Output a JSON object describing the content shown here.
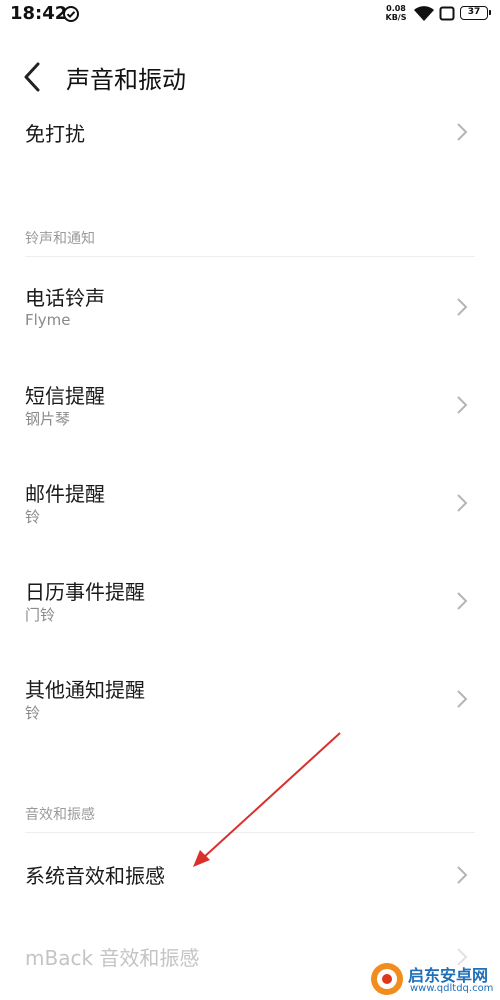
{
  "status_bar": {
    "time": "18:42",
    "net_speed_value": "0.08",
    "net_speed_unit": "KB/S",
    "battery": "37"
  },
  "header": {
    "title": "声音和振动"
  },
  "rows": {
    "dnd": {
      "title": "免打扰"
    },
    "ringtone": {
      "title": "电话铃声",
      "subtitle": "Flyme"
    },
    "sms": {
      "title": "短信提醒",
      "subtitle": "钢片琴"
    },
    "mail": {
      "title": "邮件提醒",
      "subtitle": "铃"
    },
    "calendar": {
      "title": "日历事件提醒",
      "subtitle": "门铃"
    },
    "other": {
      "title": "其他通知提醒",
      "subtitle": "铃"
    },
    "system_sound": {
      "title": "系统音效和振感"
    },
    "mback_sound": {
      "title": "mBack 音效和振感"
    }
  },
  "sections": {
    "ringtones": "铃声和通知",
    "effects": "音效和振感"
  },
  "watermark": {
    "name": "启东安卓网",
    "url": "www.qdltdq.com"
  },
  "colors": {
    "annotation_arrow": "#d9302c",
    "subtitle": "#8a8a8a",
    "section_label": "#9a9a9a"
  }
}
